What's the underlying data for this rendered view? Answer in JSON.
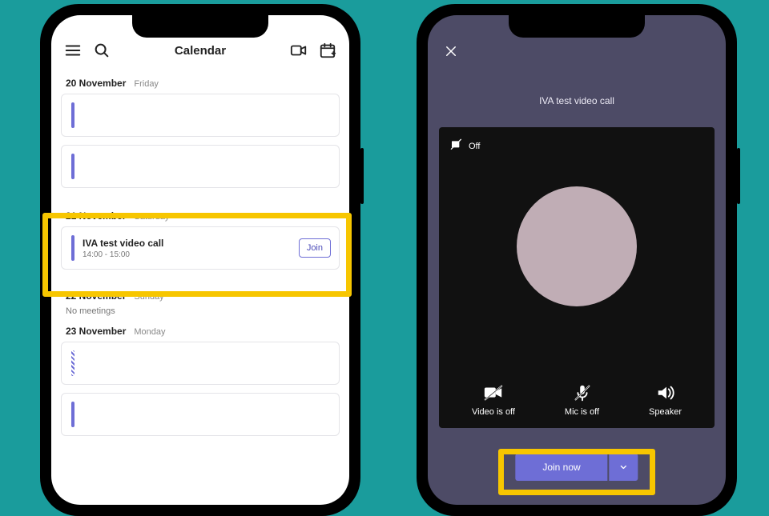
{
  "left": {
    "header": {
      "title": "Calendar"
    },
    "days": [
      {
        "date": "20 November",
        "name": "Friday"
      },
      {
        "date": "21 November",
        "name": "Saturday"
      },
      {
        "date": "22 November",
        "name": "Sunday"
      },
      {
        "date": "23 November",
        "name": "Monday"
      }
    ],
    "featured_event": {
      "title": "IVA test video call",
      "time": "14:00 - 15:00",
      "join_label": "Join"
    },
    "no_meetings_label": "No meetings"
  },
  "right": {
    "meeting_title": "IVA test video call",
    "background_effects_label": "Off",
    "controls": {
      "video": "Video is off",
      "mic": "Mic is off",
      "speaker": "Speaker"
    },
    "join_now_label": "Join now"
  }
}
